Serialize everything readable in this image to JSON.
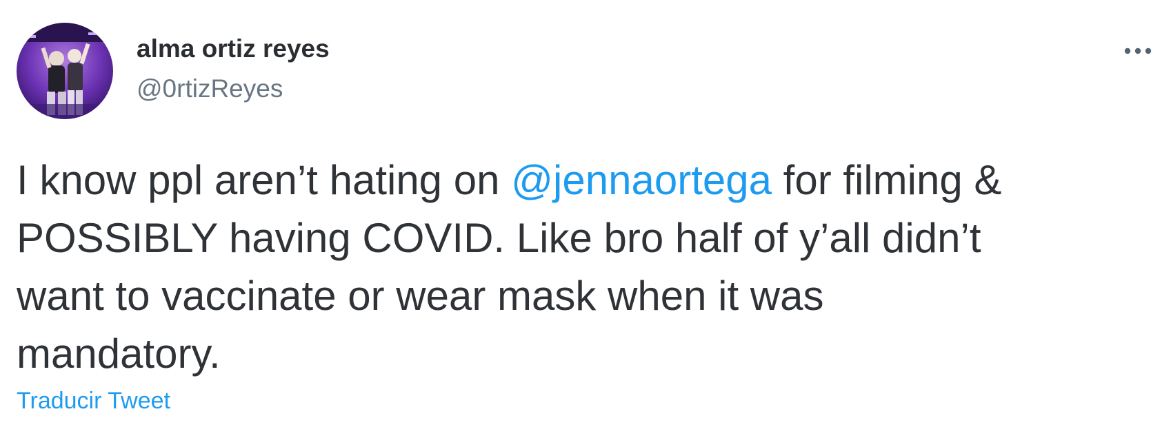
{
  "tweet": {
    "author": {
      "display_name": "alma ortiz reyes",
      "handle": "@0rtizReyes",
      "avatar_icon": "profile-photo"
    },
    "more_icon": "ellipsis-horizontal-icon",
    "text_lines": [
      {
        "before": "I know ppl aren’t hating on ",
        "mention": "@jennaortega",
        "after": " for filming &"
      },
      {
        "before": "POSSIBLY having COVID. Like bro half of y’all didn’t"
      },
      {
        "before": "want to vaccinate or wear mask when it was"
      },
      {
        "before": "mandatory."
      }
    ],
    "translate_label": "Traducir Tweet"
  },
  "colors": {
    "link": "#1d9bf0",
    "secondary_text": "#687684",
    "primary_text": "#2f3337",
    "avatar_bg": "#5a2a9a"
  }
}
